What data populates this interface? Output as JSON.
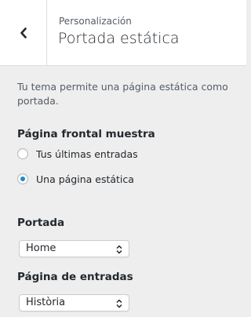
{
  "header": {
    "breadcrumb": "Personalización",
    "title": "Portada estática",
    "back_icon": "chevron-left-icon"
  },
  "description": "Tu tema permite una página estática como portada.",
  "front_page_display": {
    "label": "Página frontal muestra",
    "options": [
      {
        "label": "Tus últimas entradas",
        "checked": false
      },
      {
        "label": "Una página estática",
        "checked": true
      }
    ]
  },
  "homepage": {
    "label": "Portada",
    "selected": "Home"
  },
  "posts_page": {
    "label": "Página de entradas",
    "selected": "Història"
  },
  "colors": {
    "background": "#eeeeee",
    "accent": "#1e8cbe"
  }
}
